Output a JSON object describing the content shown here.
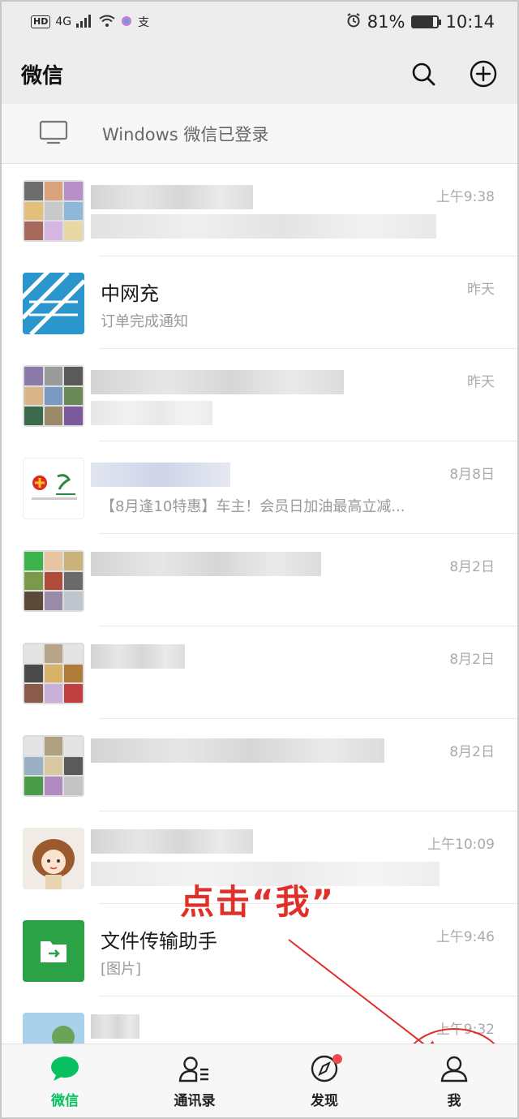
{
  "status_bar": {
    "left_badges": [
      "HD",
      "4G",
      "支"
    ],
    "alarm_icon": "alarm-icon",
    "battery": "81%",
    "battery_level": 0.81,
    "time": "10:14"
  },
  "header": {
    "title": "微信",
    "search_icon": "search-icon",
    "add_icon": "plus-circle-icon"
  },
  "login_banner": {
    "icon": "monitor-icon",
    "text": "Windows 微信已登录"
  },
  "chats": [
    {
      "name": "",
      "message": "",
      "time": "上午9:38",
      "avatar": "group"
    },
    {
      "name": "中网充",
      "message": "订单完成通知",
      "time": "昨天",
      "avatar": "logo"
    },
    {
      "name": "",
      "message": "",
      "time": "昨天",
      "avatar": "group"
    },
    {
      "name": "",
      "message": "【8月逢10特惠】车主！会员日加油最高立减...",
      "time": "8月8日",
      "avatar": "brand"
    },
    {
      "name": "",
      "message": "",
      "time": "8月2日",
      "avatar": "group"
    },
    {
      "name": "",
      "message": "",
      "time": "8月2日",
      "avatar": "group"
    },
    {
      "name": "",
      "message": "",
      "time": "8月2日",
      "avatar": "group"
    },
    {
      "name": "",
      "message": "",
      "time": "上午10:09",
      "avatar": "cartoon"
    },
    {
      "name": "文件传输助手",
      "message": "[图片]",
      "time": "上午9:46",
      "avatar": "file"
    },
    {
      "name": "",
      "message": "",
      "time": "上午9:32",
      "avatar": "photo"
    }
  ],
  "annotation": {
    "text": "点击“我”",
    "color": "#e0302a"
  },
  "tabs": [
    {
      "label": "微信",
      "icon": "chat-bubble-icon",
      "active": true
    },
    {
      "label": "通讯录",
      "icon": "contacts-icon",
      "active": false
    },
    {
      "label": "发现",
      "icon": "compass-icon",
      "active": false,
      "badge": true
    },
    {
      "label": "我",
      "icon": "user-icon",
      "active": false
    }
  ],
  "colors": {
    "accent": "#07c160",
    "badge": "#f04a4a",
    "header_bg": "#ededed"
  }
}
